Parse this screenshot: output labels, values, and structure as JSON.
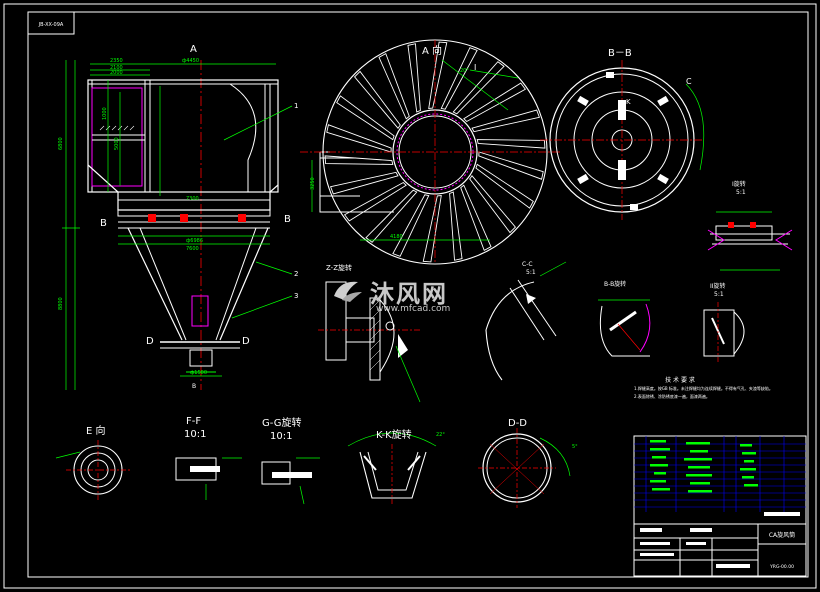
{
  "drawing": {
    "code_box": "JB-XX-09A",
    "view_a_top": "A",
    "view_a_bottom": "B",
    "view_a_section": "A 向",
    "view_bb": "B－B",
    "view_ee": "E 向",
    "view_ff": "F-F",
    "scale_ff": "10:1",
    "view_gg": "G-G旋转",
    "scale_gg": "10:1",
    "view_kk": "K-K旋转",
    "view_dd": "D-D",
    "view_zz": "Z-Z旋转",
    "view_cc": "C-C",
    "scale_cc": "5:1",
    "view_bbr": "B-B旋转",
    "view_ii": "II旋转",
    "scale_ii": "5:1",
    "view_i": "I旋转",
    "scale_i": "5:1",
    "tech_title": "技 术 要 求",
    "tech_text_1": "1.焊缝高度。按GB 标准。未注焊缝均为连续焊缝。不得有气孔、夹渣等缺陷。",
    "tech_text_2": "2.表面除锈、涂防锈底漆一遍，面漆两遍。"
  },
  "dims": {
    "d_4450": "ф4450",
    "d_2350": "2350",
    "d_2100": "2100",
    "d_2000": "2000",
    "d_1000": "1000",
    "d_5000": "5000",
    "d_7300": "7300",
    "d_7600": "7600",
    "d_6986": "ф6986",
    "d_6800": "6800",
    "d_8800": "8800",
    "d_1500": "ф1500",
    "d_4180": "4180",
    "d_3250": "3250",
    "d_20deg": "20°",
    "d_22deg": "22°",
    "d_5deg": "5°"
  },
  "labels": {
    "letter_b_left": "B",
    "letter_b_right": "B",
    "letter_d_left": "D",
    "letter_d_right": "D",
    "letter_e": "E",
    "letter_c": "C",
    "letter_k": "K",
    "letter_i": "I",
    "callout_1": "1",
    "callout_2": "2",
    "callout_3": "3"
  },
  "watermark": {
    "main": "沐风网",
    "sub": "www.mfcad.com"
  },
  "title_block": {
    "name": "CA旋风筒",
    "code": "YRG-00.00"
  },
  "colors": {
    "background": "#000000",
    "frame": "#ffffff",
    "outline": "#ffffff",
    "dimension": "#00ff00",
    "centerline": "#ff0000",
    "hidden": "#ff00ff",
    "text": "#ffffff",
    "grid": "#0000ff",
    "bars": "#00ff00"
  }
}
